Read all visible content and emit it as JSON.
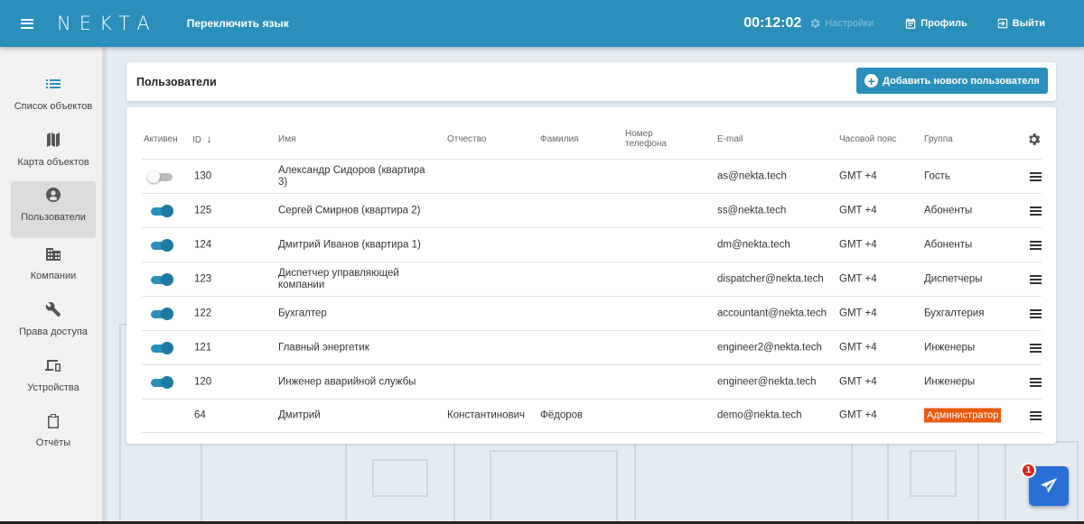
{
  "topbar": {
    "logo": "NEKTA",
    "lang_toggle": "Переключить язык",
    "timer": "00:12:02",
    "settings_label": "Настройки",
    "profile_label": "Профиль",
    "logout_label": "Выйти",
    "color": "#2a8fba"
  },
  "sidebar": {
    "items": [
      {
        "label": "Список объектов",
        "icon": "list-icon"
      },
      {
        "label": "Карта объектов",
        "icon": "map-icon"
      },
      {
        "label": "Пользователи",
        "icon": "user-circle-icon",
        "active": true
      },
      {
        "label": "Компании",
        "icon": "building-icon"
      },
      {
        "label": "Права доступа",
        "icon": "wrench-icon"
      },
      {
        "label": "Устройства",
        "icon": "devices-icon"
      },
      {
        "label": "Отчёты",
        "icon": "clipboard-icon"
      }
    ]
  },
  "header": {
    "title": "Пользователи",
    "add_button": "Добавить нового пользователя"
  },
  "table": {
    "columns": {
      "active": "Активен",
      "id": "ID",
      "sort_indicator": "↓",
      "first_name": "Имя",
      "patronymic": "Отчество",
      "last_name": "Фамилия",
      "phone": "Номер телефона",
      "email": "E-mail",
      "timezone": "Часовой пояс",
      "group": "Группа"
    },
    "rows": [
      {
        "active": false,
        "id": "130",
        "name": "Александр Сидоров (квартира 3)",
        "patronymic": "",
        "last_name": "",
        "phone": "",
        "email": "as@nekta.tech",
        "tz": "GMT +4",
        "group": "Гость"
      },
      {
        "active": true,
        "id": "125",
        "name": "Сергей Смирнов (квартира 2)",
        "patronymic": "",
        "last_name": "",
        "phone": "",
        "email": "ss@nekta.tech",
        "tz": "GMT +4",
        "group": "Абоненты"
      },
      {
        "active": true,
        "id": "124",
        "name": "Дмитрий Иванов (квартира 1)",
        "patronymic": "",
        "last_name": "",
        "phone": "",
        "email": "dm@nekta.tech",
        "tz": "GMT +4",
        "group": "Абоненты"
      },
      {
        "active": true,
        "id": "123",
        "name": "Диспетчер управляющей компании",
        "patronymic": "",
        "last_name": "",
        "phone": "",
        "email": "dispatcher@nekta.tech",
        "tz": "GMT +4",
        "group": "Диспетчеры"
      },
      {
        "active": true,
        "id": "122",
        "name": "Бухгалтер",
        "patronymic": "",
        "last_name": "",
        "phone": "",
        "email": "accountant@nekta.tech",
        "tz": "GMT +4",
        "group": "Бухгалтерия"
      },
      {
        "active": true,
        "id": "121",
        "name": "Главный энергетик",
        "patronymic": "",
        "last_name": "",
        "phone": "",
        "email": "engineer2@nekta.tech",
        "tz": "GMT +4",
        "group": "Инженеры"
      },
      {
        "active": true,
        "id": "120",
        "name": "Инженер аварийной службы",
        "patronymic": "",
        "last_name": "",
        "phone": "",
        "email": "engineer@nekta.tech",
        "tz": "GMT +4",
        "group": "Инженеры"
      },
      {
        "active": null,
        "id": "64",
        "name": "Дмитрий",
        "patronymic": "Константинович",
        "last_name": "Фёдоров",
        "phone": "",
        "email": "demo@nekta.tech",
        "tz": "GMT +4",
        "group": "Администратор",
        "group_badge": true
      }
    ]
  },
  "fab": {
    "icon": "paper-plane-icon",
    "badge_count": "1"
  },
  "colors": {
    "accent": "#2a8fba",
    "admin_badge": "#e85b0f",
    "notification": "#d9261c"
  }
}
